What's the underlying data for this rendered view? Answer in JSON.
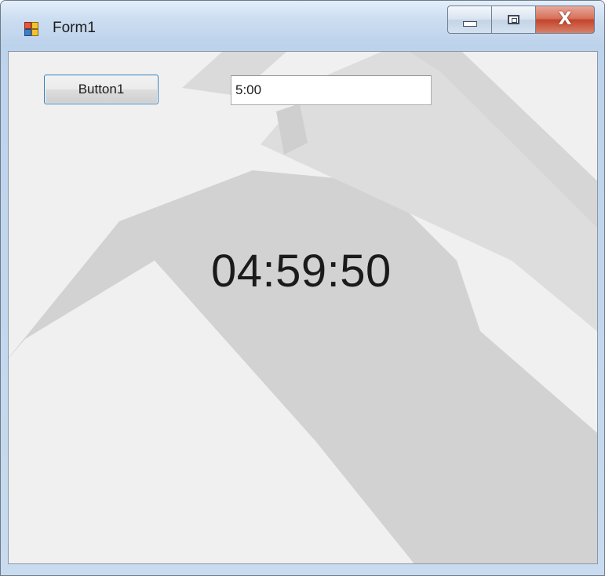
{
  "window": {
    "title": "Form1",
    "icon": "winforms-app-icon",
    "controls": {
      "minimize_icon": "minimize-icon",
      "maximize_icon": "maximize-icon",
      "close_label": "X"
    }
  },
  "form": {
    "button_label": "Button1",
    "textbox_value": "5:00",
    "time_display": "04:59:50"
  },
  "colors": {
    "client_background": "#f0f0f0",
    "button_focus_border": "#3c7fb1",
    "close_button": "#c4442b",
    "titlebar": "#cadcf0"
  }
}
